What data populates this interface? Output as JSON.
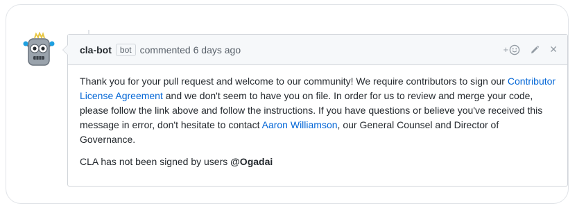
{
  "comment": {
    "author": "cla-bot",
    "badge": "bot",
    "action": "commented 6 days ago",
    "body": {
      "p1_a": "Thank you for your pull request and welcome to our community! We require contributors to sign our ",
      "p1_link1": "Contributor License Agreement",
      "p1_b": " and we don't seem to have you on file. In order for us to review and merge your code, please follow the link above and follow the instructions. If you have questions or believe you've received this message in error, don't hesitate to contact ",
      "p1_link2": "Aaron Williamson",
      "p1_c": ", our General Counsel and Director of Governance.",
      "p2_a": "CLA has not been signed by users ",
      "p2_user": "@Ogadai"
    },
    "actions": {
      "reaction_plus": "+",
      "reaction_icon": "smiley-icon",
      "edit_icon": "pencil-icon",
      "close_label": "✕"
    }
  },
  "colors": {
    "link": "#0366d6",
    "header_bg": "#f6f8fa",
    "border": "#d1d5da",
    "muted": "#586069"
  }
}
